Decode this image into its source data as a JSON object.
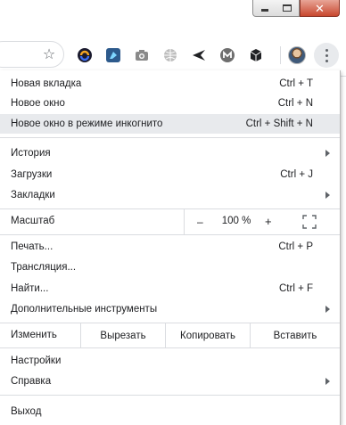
{
  "window": {
    "minimize_icon": "minimize-icon",
    "maximize_icon": "maximize-icon",
    "close_icon": "close-icon",
    "close_color": "#c8472e"
  },
  "toolbar": {
    "bookmark_icon": "star-icon",
    "extensions": [
      "swipe-extension-icon",
      "feedly-extension-icon",
      "camera-extension-icon",
      "globe-extension-icon",
      "arrow-extension-icon",
      "mega-extension-icon",
      "cube-extension-icon"
    ],
    "profile": "avatar",
    "menu_icon": "kebab-menu-icon"
  },
  "menu": {
    "new_tab": {
      "label": "Новая вкладка",
      "shortcut": "Ctrl + T"
    },
    "new_window": {
      "label": "Новое окно",
      "shortcut": "Ctrl + N"
    },
    "incognito": {
      "label": "Новое окно в режиме инкогнито",
      "shortcut": "Ctrl + Shift + N"
    },
    "history": {
      "label": "История"
    },
    "downloads": {
      "label": "Загрузки",
      "shortcut": "Ctrl + J"
    },
    "bookmarks": {
      "label": "Закладки"
    },
    "zoom": {
      "label": "Масштаб",
      "minus": "–",
      "value": "100 %",
      "plus": "+"
    },
    "print": {
      "label": "Печать...",
      "shortcut": "Ctrl + P"
    },
    "cast": {
      "label": "Трансляция..."
    },
    "find": {
      "label": "Найти...",
      "shortcut": "Ctrl + F"
    },
    "more_tools": {
      "label": "Дополнительные инструменты"
    },
    "edit": {
      "label": "Изменить",
      "cut": "Вырезать",
      "copy": "Копировать",
      "paste": "Вставить"
    },
    "settings": {
      "label": "Настройки"
    },
    "help": {
      "label": "Справка"
    },
    "exit": {
      "label": "Выход"
    },
    "highlight_color": "#e8eaed"
  }
}
